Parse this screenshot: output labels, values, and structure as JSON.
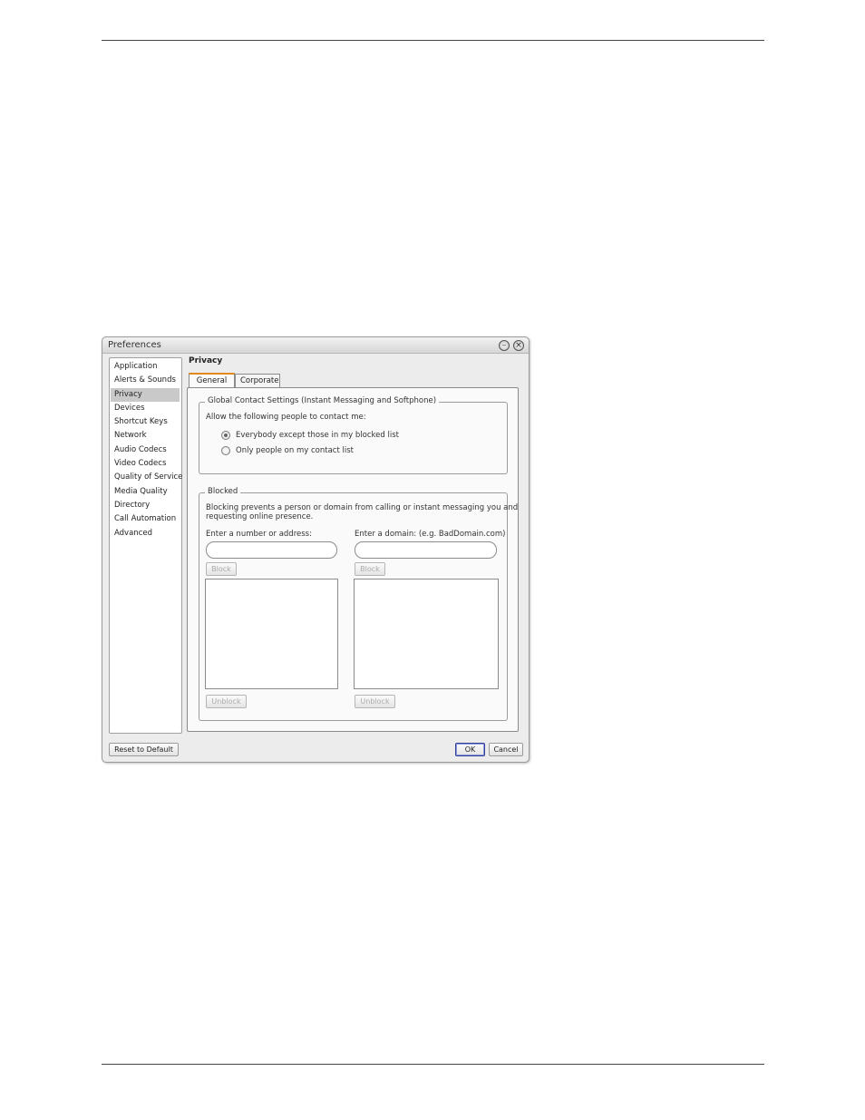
{
  "window": {
    "title": "Preferences",
    "minimize_glyph": "–",
    "close_glyph": "×"
  },
  "sidebar": {
    "items": [
      {
        "label": "Application"
      },
      {
        "label": "Alerts & Sounds"
      },
      {
        "label": "Privacy"
      },
      {
        "label": "Devices"
      },
      {
        "label": "Shortcut Keys"
      },
      {
        "label": "Network"
      },
      {
        "label": "Audio Codecs"
      },
      {
        "label": "Video Codecs"
      },
      {
        "label": "Quality of Service"
      },
      {
        "label": "Media Quality"
      },
      {
        "label": "Directory"
      },
      {
        "label": "Call Automation"
      },
      {
        "label": "Advanced"
      }
    ],
    "selected": "Privacy"
  },
  "main": {
    "section_title": "Privacy",
    "tabs": [
      {
        "label": "General",
        "active": true
      },
      {
        "label": "Corporate",
        "active": false
      }
    ],
    "global": {
      "legend": "Global Contact Settings (Instant Messaging and Softphone)",
      "prompt": "Allow the following people to contact me:",
      "options": [
        {
          "label": "Everybody except those in my blocked list",
          "checked": true
        },
        {
          "label": "Only people on my contact list",
          "checked": false
        }
      ]
    },
    "blocked": {
      "legend": "Blocked",
      "description_line1": "Blocking prevents a person or domain from calling or instant messaging you and",
      "description_line2": "requesting online presence.",
      "address_label": "Enter a number or address:",
      "address_value": "",
      "domain_label": "Enter a domain: (e.g. BadDomain.com)",
      "domain_value": "",
      "block_label": "Block",
      "unblock_label": "Unblock"
    }
  },
  "footer": {
    "reset_label": "Reset to Default",
    "ok_label": "OK",
    "cancel_label": "Cancel"
  }
}
